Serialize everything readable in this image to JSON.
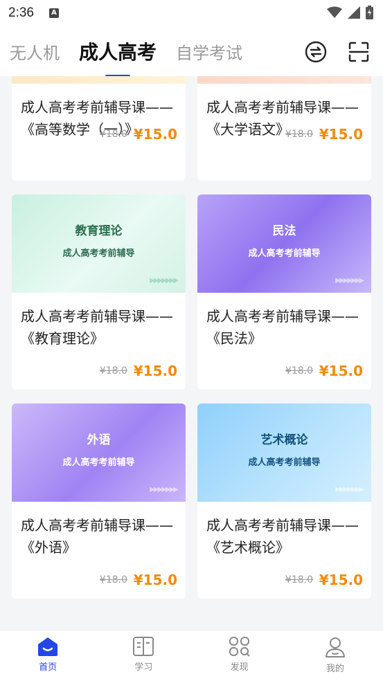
{
  "status_bar": {
    "time": "2:36",
    "notification_icon": "A"
  },
  "tabs": [
    {
      "label": "无人机",
      "active": false
    },
    {
      "label": "成人高考",
      "active": true
    },
    {
      "label": "自学考试",
      "active": false
    }
  ],
  "header_icons": [
    "switch-icon",
    "scan-icon"
  ],
  "courses": [
    {
      "title": "成人高考考前辅导课——《高等数学（一）》",
      "price_old": "¥18.0",
      "price_new": "¥15.0"
    },
    {
      "title": "成人高考考前辅导课——《大学语文》",
      "price_old": "¥18.0",
      "price_new": "¥15.0"
    },
    {
      "title": "成人高考考前辅导课——《教育理论》",
      "banner_title": "教育理论",
      "banner_sub": "成人高考考前辅导",
      "price_old": "¥18.0",
      "price_new": "¥15.0"
    },
    {
      "title": "成人高考考前辅导课——《民法》",
      "banner_title": "民法",
      "banner_sub": "成人高考考前辅导",
      "price_old": "¥18.0",
      "price_new": "¥15.0"
    },
    {
      "title": "成人高考考前辅导课——《外语》",
      "banner_title": "外语",
      "banner_sub": "成人高考考前辅导",
      "price_old": "¥18.0",
      "price_new": "¥15.0"
    },
    {
      "title": "成人高考考前辅导课——《艺术概论》",
      "banner_title": "艺术概论",
      "banner_sub": "成人高考考前辅导",
      "price_old": "¥18.0",
      "price_new": "¥15.0"
    }
  ],
  "bottom_nav": [
    {
      "label": "首页",
      "icon": "home-icon",
      "active": true
    },
    {
      "label": "学习",
      "icon": "book-icon",
      "active": false
    },
    {
      "label": "发现",
      "icon": "discover-icon",
      "active": false
    },
    {
      "label": "我的",
      "icon": "profile-icon",
      "active": false
    }
  ],
  "colors": {
    "accent": "#2346e8",
    "price": "#f58a0a"
  }
}
